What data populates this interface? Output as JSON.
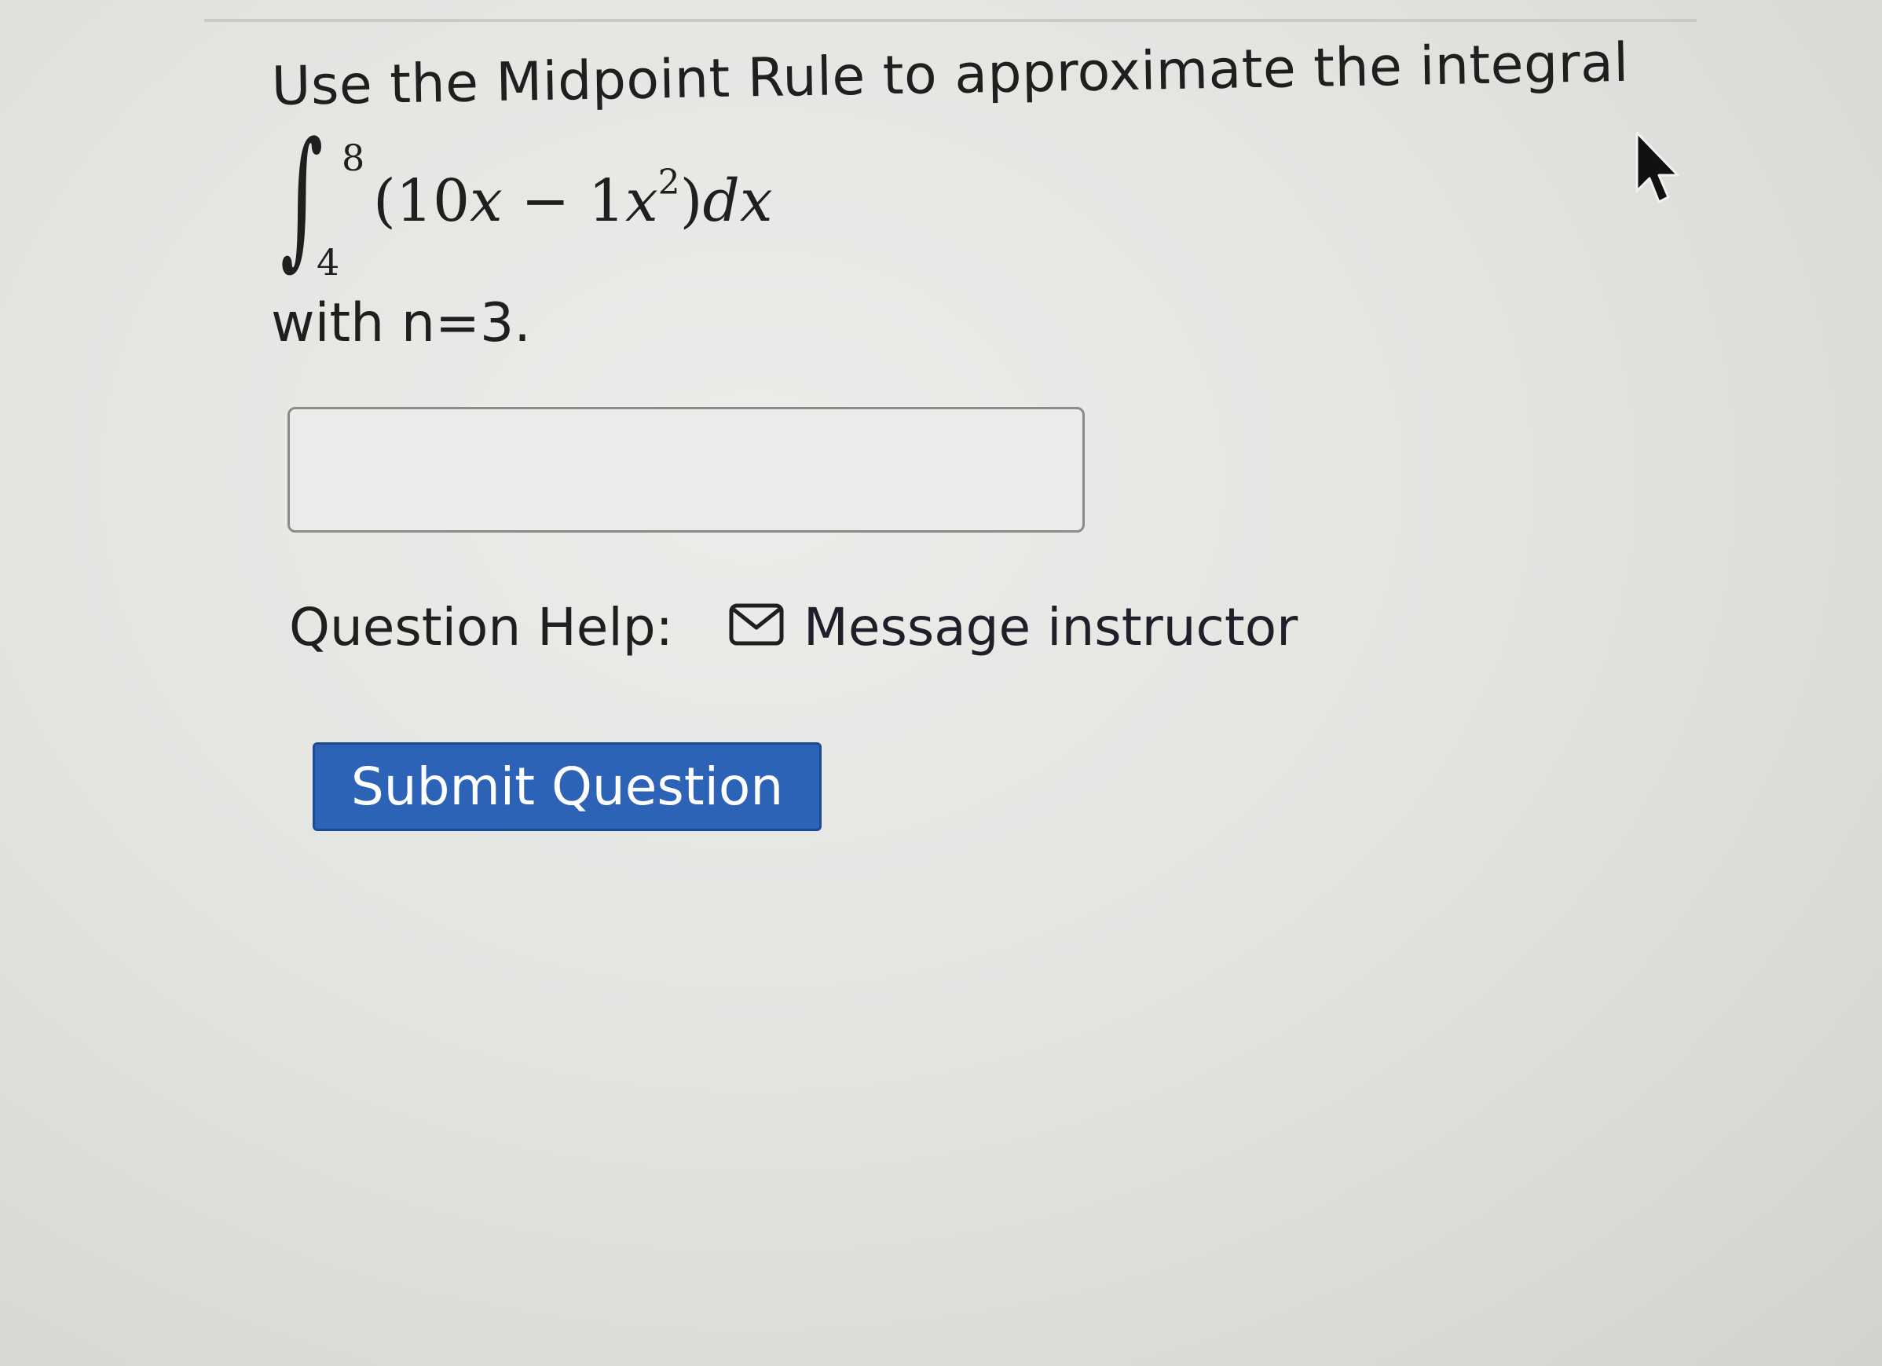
{
  "question": {
    "prompt": "Use the Midpoint Rule to approximate the integral",
    "integral": {
      "upper_limit": "8",
      "lower_limit": "4",
      "open_paren": "(",
      "coef1": "10",
      "var1": "x",
      "minus": " − ",
      "coef2": "1",
      "var2": "x",
      "exponent": "2",
      "close_paren": ")",
      "differential": "dx"
    },
    "condition": "with n=3."
  },
  "answer": {
    "value": "",
    "placeholder": ""
  },
  "help": {
    "label": "Question Help:",
    "message_link": "Message instructor"
  },
  "submit": {
    "label": "Submit Question",
    "color": "#2c63b6"
  },
  "icons": {
    "mail": "envelope-icon",
    "pointer": "mouse-cursor-icon"
  }
}
